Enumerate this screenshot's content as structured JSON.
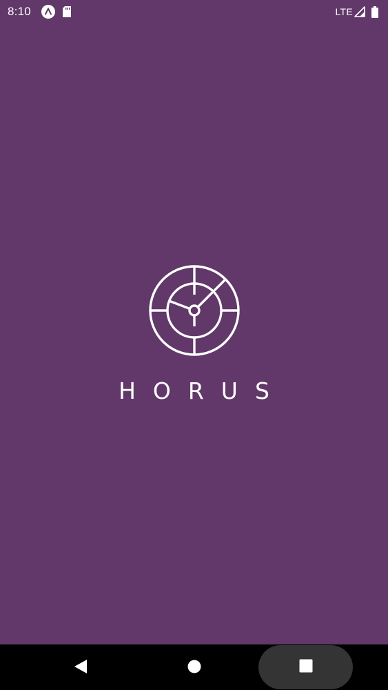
{
  "status_bar": {
    "time": "8:10",
    "network": "LTE",
    "icons": {
      "app": "app-notification-icon",
      "sd": "sd-card-icon",
      "signal": "cell-signal-icon",
      "battery": "battery-icon"
    }
  },
  "splash": {
    "brand_name": "HORUS",
    "logo": "horus-radar-logo-icon"
  },
  "nav_bar": {
    "icons": {
      "back": "back-triangle-icon",
      "home": "home-circle-icon",
      "recents": "recents-square-icon"
    }
  },
  "colors": {
    "background": "#62386a",
    "foreground": "#ffffff",
    "nav_background": "#000000",
    "recents_highlight": "#343434"
  }
}
